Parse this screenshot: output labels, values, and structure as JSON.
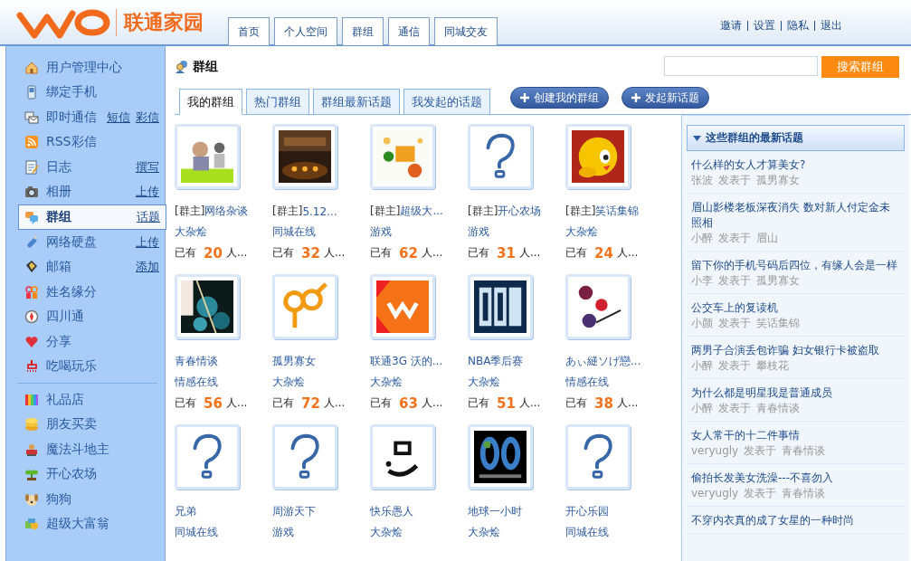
{
  "header": {
    "logo_text": "联通家园",
    "nav": [
      {
        "label": "首页",
        "selected": false
      },
      {
        "label": "个人空间",
        "selected": false
      },
      {
        "label": "群组",
        "selected": false
      },
      {
        "label": "通信",
        "selected": false
      },
      {
        "label": "同城交友",
        "selected": false
      }
    ],
    "user_links": [
      "邀请",
      "设置",
      "隐私",
      "退出"
    ]
  },
  "sidebar": {
    "sections": [
      {
        "items": [
          {
            "label": "用户管理中心",
            "selected": false
          },
          {
            "label": "绑定手机",
            "selected": false
          },
          {
            "label": "即时通信",
            "links": [
              "短信",
              "彩信"
            ],
            "selected": false
          },
          {
            "label": "RSS彩信",
            "selected": false
          },
          {
            "label": "日志",
            "links": [
              "撰写"
            ],
            "selected": false
          },
          {
            "label": "相册",
            "links": [
              "上传"
            ],
            "selected": false
          },
          {
            "label": "群组",
            "links": [
              "话题"
            ],
            "selected": true
          },
          {
            "label": "网络硬盘",
            "links": [
              "上传"
            ],
            "selected": false
          },
          {
            "label": "邮箱",
            "links": [
              "添加"
            ],
            "selected": false
          },
          {
            "label": "姓名缘分",
            "selected": false
          },
          {
            "label": "四川通",
            "selected": false
          },
          {
            "label": "分享",
            "selected": false
          },
          {
            "label": "吃喝玩乐",
            "selected": false
          }
        ]
      },
      {
        "items": [
          {
            "label": "礼品店",
            "selected": false
          },
          {
            "label": "朋友买卖",
            "selected": false
          },
          {
            "label": "魔法斗地主",
            "selected": false
          },
          {
            "label": "开心农场",
            "selected": false
          },
          {
            "label": "狗狗",
            "selected": false
          },
          {
            "label": "超级大富翁",
            "selected": false
          }
        ]
      }
    ]
  },
  "main": {
    "title": "群组",
    "search": {
      "button": "搜索群组"
    },
    "tabs": [
      {
        "label": "我的群组",
        "selected": true
      },
      {
        "label": "热门群组",
        "selected": false
      },
      {
        "label": "群组最新话题",
        "selected": false
      },
      {
        "label": "我发起的话题",
        "selected": false
      }
    ],
    "actions": [
      "创建我的群组",
      "发起新话题"
    ],
    "groups": [
      {
        "kind": "picture",
        "owner_tag": "[群主]",
        "name": "网络杂谈",
        "category": "大杂烩",
        "members": {
          "prefix": "已有",
          "count": "20",
          "suffix": "人..."
        }
      },
      {
        "kind": "picture",
        "owner_tag": "[群主]",
        "name": "5.12...",
        "category": "同城在线",
        "members": {
          "prefix": "已有",
          "count": "32",
          "suffix": "人..."
        }
      },
      {
        "kind": "picture",
        "owner_tag": "[群主]",
        "name": "超级大...",
        "category": "游戏",
        "members": {
          "prefix": "已有",
          "count": "62",
          "suffix": "人..."
        }
      },
      {
        "kind": "placeholder",
        "owner_tag": "[群主]",
        "name": "开心农场",
        "category": "游戏",
        "members": {
          "prefix": "已有",
          "count": "31",
          "suffix": "人..."
        }
      },
      {
        "kind": "picture",
        "owner_tag": "[群主]",
        "name": "笑话集锦",
        "category": "大杂烩",
        "members": {
          "prefix": "已有",
          "count": "24",
          "suffix": "人..."
        }
      },
      {
        "kind": "picture",
        "name": "青春情谈",
        "category": "情感在线",
        "members": {
          "prefix": "已有",
          "count": "56",
          "suffix": "人..."
        }
      },
      {
        "kind": "picture",
        "name": "孤男寡女",
        "category": "大杂烩",
        "members": {
          "prefix": "已有",
          "count": "72",
          "suffix": "人..."
        }
      },
      {
        "kind": "picture",
        "name": "联通3G 沃的...",
        "category": "大杂烩",
        "members": {
          "prefix": "已有",
          "count": "63",
          "suffix": "人..."
        }
      },
      {
        "kind": "picture",
        "name": "NBA季后赛",
        "category": "大杂烩",
        "members": {
          "prefix": "已有",
          "count": "51",
          "suffix": "人..."
        }
      },
      {
        "kind": "picture",
        "name": "あぃ縌ソげ戀...",
        "category": "情感在线",
        "members": {
          "prefix": "已有",
          "count": "38",
          "suffix": "人..."
        }
      },
      {
        "kind": "placeholder",
        "name": "兄弟",
        "category": "同城在线"
      },
      {
        "kind": "placeholder",
        "name": "周游天下",
        "category": "游戏"
      },
      {
        "kind": "picture",
        "name": "快乐愚人",
        "category": "大杂烩"
      },
      {
        "kind": "picture",
        "name": "地球一小时",
        "category": "大杂烩"
      },
      {
        "kind": "placeholder",
        "name": "开心乐园",
        "category": "同城在线"
      }
    ]
  },
  "topics_panel": {
    "title": "这些群组的最新话题",
    "expanded": true,
    "topics": [
      {
        "title": "什么样的女人才算美女?",
        "author": "张波",
        "verb": "发表于",
        "group": "孤男寡女"
      },
      {
        "title": "眉山影楼老板深夜消失 数对新人付定金未照相",
        "author": "小醉",
        "verb": "发表于",
        "group": "眉山"
      },
      {
        "title": "留下你的手机号码后四位，有缘人会是一样",
        "author": "小李",
        "verb": "发表于",
        "group": "孤男寡女"
      },
      {
        "title": "公交车上的复读机",
        "author": "小颜",
        "verb": "发表于",
        "group": "笑话集锦"
      },
      {
        "title": "两男子合演丢包诈骗 妇女银行卡被盗取",
        "author": "小醉",
        "verb": "发表于",
        "group": "攀枝花"
      },
      {
        "title": "为什么都是明星我是普通成员",
        "author": "小醉",
        "verb": "发表于",
        "group": "青春情谈"
      },
      {
        "title": "女人常干的十二件事情",
        "author": "veryugly",
        "verb": "发表于",
        "group": "青春情谈"
      },
      {
        "title": "偷拍长发美女洗澡---不喜勿入",
        "author": "veryugly",
        "verb": "发表于",
        "group": "青春情谈"
      },
      {
        "title": "不穿内衣真的成了女星的一种时尚"
      }
    ]
  }
}
